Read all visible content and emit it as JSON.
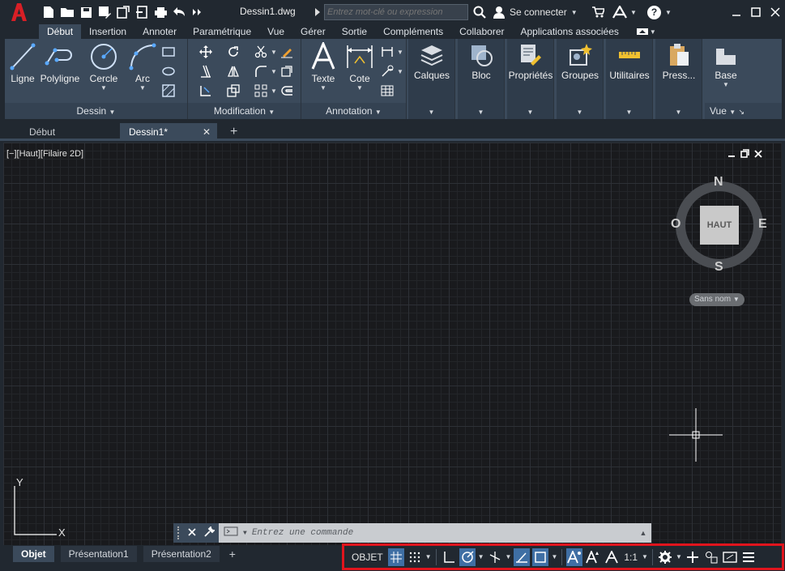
{
  "app": {
    "logo_letter": "A",
    "document_title": "Dessin1.dwg",
    "search_placeholder": "Entrez mot-clé ou expression",
    "user_label": "Se connecter",
    "help_label": "?"
  },
  "ribbon_tabs": [
    "Début",
    "Insertion",
    "Annoter",
    "Paramétrique",
    "Vue",
    "Gérer",
    "Sortie",
    "Compléments",
    "Collaborer",
    "Applications associées"
  ],
  "ribbon": {
    "draw_panel": {
      "title": "Dessin",
      "tools": [
        "Ligne",
        "Polyligne",
        "Cercle",
        "Arc"
      ]
    },
    "modify_panel": {
      "title": "Modification"
    },
    "annotation_panel": {
      "title": "Annotation",
      "tools": [
        "Texte",
        "Cote"
      ]
    },
    "calques": "Calques",
    "bloc": "Bloc",
    "proprietes": "Propriétés",
    "groupes": "Groupes",
    "utilitaires": "Utilitaires",
    "presse": "Press...",
    "base": "Base",
    "vue": "Vue"
  },
  "file_tabs": {
    "start": "Début",
    "active": "Dessin1*",
    "close": "✕",
    "add": "+"
  },
  "viewport": {
    "label": "[−][Haut][Filaire 2D]",
    "viewcube_face": "HAUT",
    "compass": {
      "n": "N",
      "s": "S",
      "e": "E",
      "o": "O"
    },
    "wcs": "Sans nom",
    "ucs_x": "X",
    "ucs_y": "Y"
  },
  "command": {
    "placeholder": "Entrez une commande"
  },
  "layout_tabs": [
    "Objet",
    "Présentation1",
    "Présentation2"
  ],
  "status": {
    "model": "OBJET",
    "scale": "1:1"
  },
  "colors": {
    "accent_blue": "#3f6fa4",
    "logo_red": "#d81f26",
    "status_border": "#e0141d"
  }
}
